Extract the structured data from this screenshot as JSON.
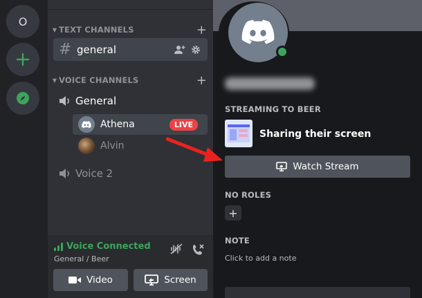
{
  "server_rail": {
    "home_initial": "O",
    "icons": [
      "add-server-icon",
      "explore-compass-icon"
    ]
  },
  "channels": {
    "text_category": "TEXT CHANNELS",
    "text_channel": "general",
    "voice_category": "VOICE CHANNELS",
    "voice_channels": [
      {
        "name": "General",
        "members": [
          {
            "name": "Athena",
            "badge": "LIVE"
          },
          {
            "name": "Alvin"
          }
        ]
      },
      {
        "name": "Voice 2"
      }
    ]
  },
  "voice_panel": {
    "status": "Voice Connected",
    "location": "General / Beer",
    "video_label": "Video",
    "screen_label": "Screen"
  },
  "profile": {
    "streaming_heading": "STREAMING TO BEER",
    "stream_text": "Sharing their screen",
    "watch_label": "Watch Stream",
    "roles_heading": "NO ROLES",
    "roles_add": "+",
    "note_heading": "NOTE",
    "note_placeholder": "Click to add a note"
  },
  "colors": {
    "online": "#3ba55c",
    "live": "#ed4245",
    "annotation_arrow": "#e8231f",
    "discord_blurple_gray": "#747f8d"
  }
}
